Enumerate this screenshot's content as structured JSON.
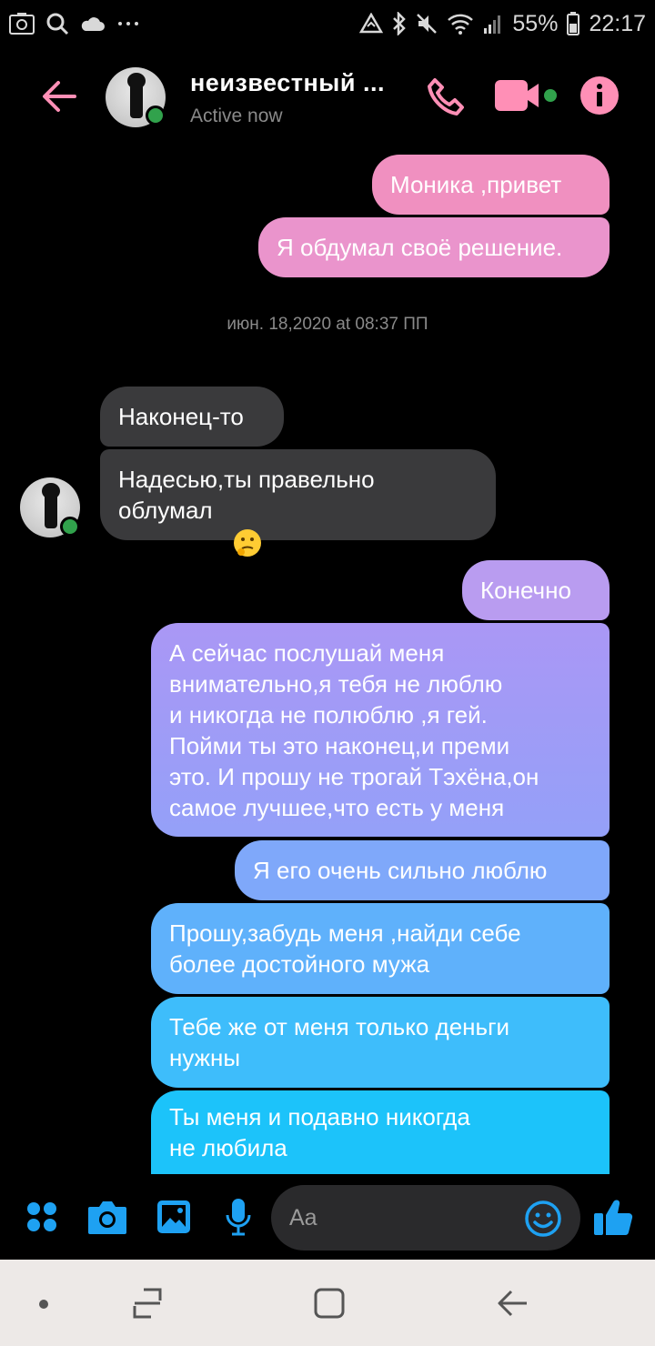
{
  "status_bar": {
    "battery": "55%",
    "time": "22:17",
    "icons": [
      "screenshot-icon",
      "search-icon",
      "cloud-icon",
      "more-icon",
      "data-saver-icon",
      "bluetooth-icon",
      "mute-icon",
      "wifi-icon",
      "signal-icon",
      "battery-icon"
    ]
  },
  "header": {
    "contact_name": "неизвестный ...",
    "status": "Active now",
    "colors": {
      "accent": "#ff8fb6",
      "online": "#31a24c"
    }
  },
  "conversation": {
    "timestamp": "июн. 18,2020 at 08:37 ПП",
    "sent_top": [
      {
        "text": "Моника ,привет"
      },
      {
        "text": "Я обдумал своё решение."
      }
    ],
    "received": [
      {
        "text": "Наконец-то"
      },
      {
        "text": "Надесью,ты правельно\nоблумал",
        "emoji": "thinking-face"
      }
    ],
    "sent_bottom": [
      {
        "text": "Конечно"
      },
      {
        "text": "А сейчас послушай меня\nвнимательно,я тебя не люблю\nи  никогда не полюблю ,я гей.\nПойми ты это наконец,и преми\nэто. И прошу не трогай Тэхёна,он\nсамое лучшее,что есть у меня"
      },
      {
        "text": "Я его очень сильно люблю"
      },
      {
        "text": "Прошу,забудь меня ,найди себе\nболее достойного мужа"
      },
      {
        "text": "Тебе же от меня только деньги\nнужны"
      },
      {
        "text": "Ты меня и подавно никогда\nне любила"
      }
    ]
  },
  "composer": {
    "placeholder": "Aa",
    "accent": "#1ea1f2",
    "icons": [
      "apps-icon",
      "camera-icon",
      "image-icon",
      "mic-icon",
      "emoji-icon",
      "thumbs-up-icon"
    ]
  },
  "nav_bar": {
    "icons": [
      "nav-dot-icon",
      "recents-icon",
      "home-icon",
      "back-icon"
    ]
  }
}
